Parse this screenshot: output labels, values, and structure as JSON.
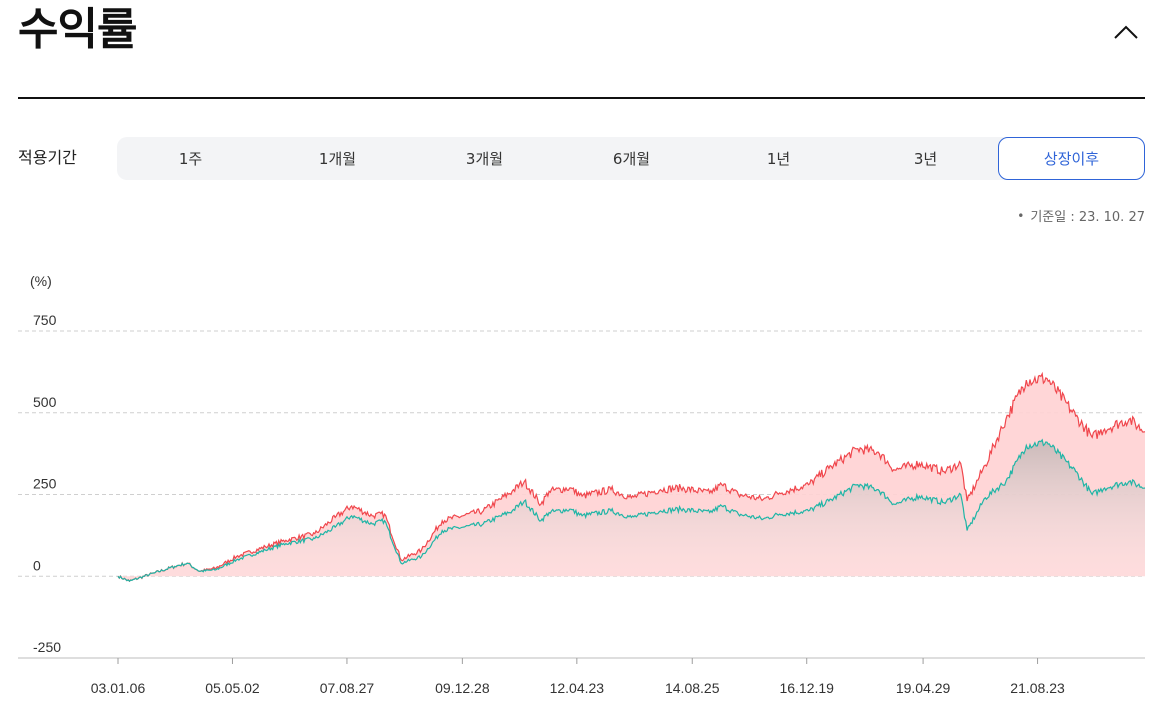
{
  "header": {
    "title": "수익률",
    "collapse_icon": "chevron-up-icon"
  },
  "period": {
    "label": "적용기간",
    "tabs": [
      "1주",
      "1개월",
      "3개월",
      "6개월",
      "1년",
      "3년",
      "상장이후"
    ],
    "active_index": 6
  },
  "reference_date": "기준일 : 23. 10. 27",
  "colors": {
    "fund_line": "#f0474d",
    "benchmark_line": "#1fb5a6",
    "fund_area": "#ffd1d3",
    "active_tab": "#2f64d8"
  },
  "chart_data": {
    "type": "area",
    "y_unit_label": "(%)",
    "ylim": [
      -250,
      750
    ],
    "y_ticks": [
      750,
      500,
      250,
      0,
      -250
    ],
    "x_tick_labels": [
      "03.01.06",
      "05.05.02",
      "07.08.27",
      "09.12.28",
      "12.04.23",
      "14.08.25",
      "16.12.19",
      "19.04.29",
      "21.08.23"
    ],
    "x_tick_dates": [
      "2003-01-06",
      "2005-05-02",
      "2007-08-27",
      "2009-12-28",
      "2012-04-23",
      "2014-08-25",
      "2016-12-19",
      "2019-04-29",
      "2021-08-23"
    ],
    "x_range": [
      "2003-01-06",
      "2023-10-27"
    ],
    "grid": "horizontal-dashed",
    "legend": "none",
    "series": [
      {
        "color": "#f0474d",
        "points": [
          [
            "2003-01-06",
            0
          ],
          [
            "2003-04-01",
            -15
          ],
          [
            "2003-10-01",
            10
          ],
          [
            "2004-03-01",
            30
          ],
          [
            "2004-06-01",
            40
          ],
          [
            "2004-09-01",
            15
          ],
          [
            "2005-01-01",
            25
          ],
          [
            "2005-06-01",
            60
          ],
          [
            "2006-01-01",
            90
          ],
          [
            "2006-06-01",
            110
          ],
          [
            "2007-01-01",
            130
          ],
          [
            "2007-06-01",
            180
          ],
          [
            "2007-10-01",
            215
          ],
          [
            "2008-03-01",
            185
          ],
          [
            "2008-06-01",
            190
          ],
          [
            "2008-10-01",
            50
          ],
          [
            "2009-03-01",
            80
          ],
          [
            "2009-08-01",
            170
          ],
          [
            "2010-01-01",
            185
          ],
          [
            "2010-06-01",
            200
          ],
          [
            "2011-01-01",
            260
          ],
          [
            "2011-04-01",
            290
          ],
          [
            "2011-08-01",
            220
          ],
          [
            "2011-10-01",
            260
          ],
          [
            "2012-03-01",
            270
          ],
          [
            "2012-06-01",
            245
          ],
          [
            "2013-01-01",
            265
          ],
          [
            "2013-06-01",
            240
          ],
          [
            "2014-01-01",
            265
          ],
          [
            "2014-06-01",
            270
          ],
          [
            "2015-01-01",
            255
          ],
          [
            "2015-04-01",
            280
          ],
          [
            "2015-08-01",
            250
          ],
          [
            "2016-02-01",
            235
          ],
          [
            "2016-06-01",
            255
          ],
          [
            "2017-01-01",
            280
          ],
          [
            "2017-06-01",
            330
          ],
          [
            "2018-01-01",
            390
          ],
          [
            "2018-06-01",
            380
          ],
          [
            "2018-10-01",
            325
          ],
          [
            "2019-04-01",
            345
          ],
          [
            "2019-10-01",
            320
          ],
          [
            "2020-02-01",
            345
          ],
          [
            "2020-03-20",
            230
          ],
          [
            "2020-08-01",
            340
          ],
          [
            "2021-01-01",
            480
          ],
          [
            "2021-06-01",
            600
          ],
          [
            "2021-11-01",
            605
          ],
          [
            "2022-06-01",
            490
          ],
          [
            "2022-10-01",
            425
          ],
          [
            "2023-01-01",
            450
          ],
          [
            "2023-07-01",
            480
          ],
          [
            "2023-10-27",
            442
          ]
        ]
      },
      {
        "color": "#1fb5a6",
        "points": [
          [
            "2003-01-06",
            0
          ],
          [
            "2003-04-01",
            -15
          ],
          [
            "2003-10-01",
            10
          ],
          [
            "2004-03-01",
            30
          ],
          [
            "2004-06-01",
            40
          ],
          [
            "2004-09-01",
            15
          ],
          [
            "2005-01-01",
            20
          ],
          [
            "2005-06-01",
            50
          ],
          [
            "2006-01-01",
            80
          ],
          [
            "2006-06-01",
            100
          ],
          [
            "2007-01-01",
            115
          ],
          [
            "2007-06-01",
            150
          ],
          [
            "2007-10-01",
            185
          ],
          [
            "2008-03-01",
            160
          ],
          [
            "2008-06-01",
            170
          ],
          [
            "2008-10-01",
            40
          ],
          [
            "2009-03-01",
            60
          ],
          [
            "2009-08-01",
            140
          ],
          [
            "2010-01-01",
            150
          ],
          [
            "2010-06-01",
            160
          ],
          [
            "2011-01-01",
            200
          ],
          [
            "2011-04-01",
            230
          ],
          [
            "2011-08-01",
            170
          ],
          [
            "2011-10-01",
            195
          ],
          [
            "2012-03-01",
            205
          ],
          [
            "2012-06-01",
            185
          ],
          [
            "2013-01-01",
            200
          ],
          [
            "2013-06-01",
            180
          ],
          [
            "2014-01-01",
            200
          ],
          [
            "2014-06-01",
            205
          ],
          [
            "2015-01-01",
            195
          ],
          [
            "2015-04-01",
            215
          ],
          [
            "2015-08-01",
            190
          ],
          [
            "2016-02-01",
            175
          ],
          [
            "2016-06-01",
            190
          ],
          [
            "2017-01-01",
            200
          ],
          [
            "2017-06-01",
            230
          ],
          [
            "2018-01-01",
            280
          ],
          [
            "2018-06-01",
            265
          ],
          [
            "2018-10-01",
            220
          ],
          [
            "2019-04-01",
            245
          ],
          [
            "2019-10-01",
            225
          ],
          [
            "2020-02-01",
            250
          ],
          [
            "2020-03-20",
            140
          ],
          [
            "2020-08-01",
            240
          ],
          [
            "2021-01-01",
            290
          ],
          [
            "2021-06-01",
            400
          ],
          [
            "2021-11-01",
            410
          ],
          [
            "2022-06-01",
            320
          ],
          [
            "2022-10-01",
            250
          ],
          [
            "2023-01-01",
            270
          ],
          [
            "2023-07-01",
            290
          ],
          [
            "2023-10-27",
            270
          ]
        ]
      }
    ]
  }
}
